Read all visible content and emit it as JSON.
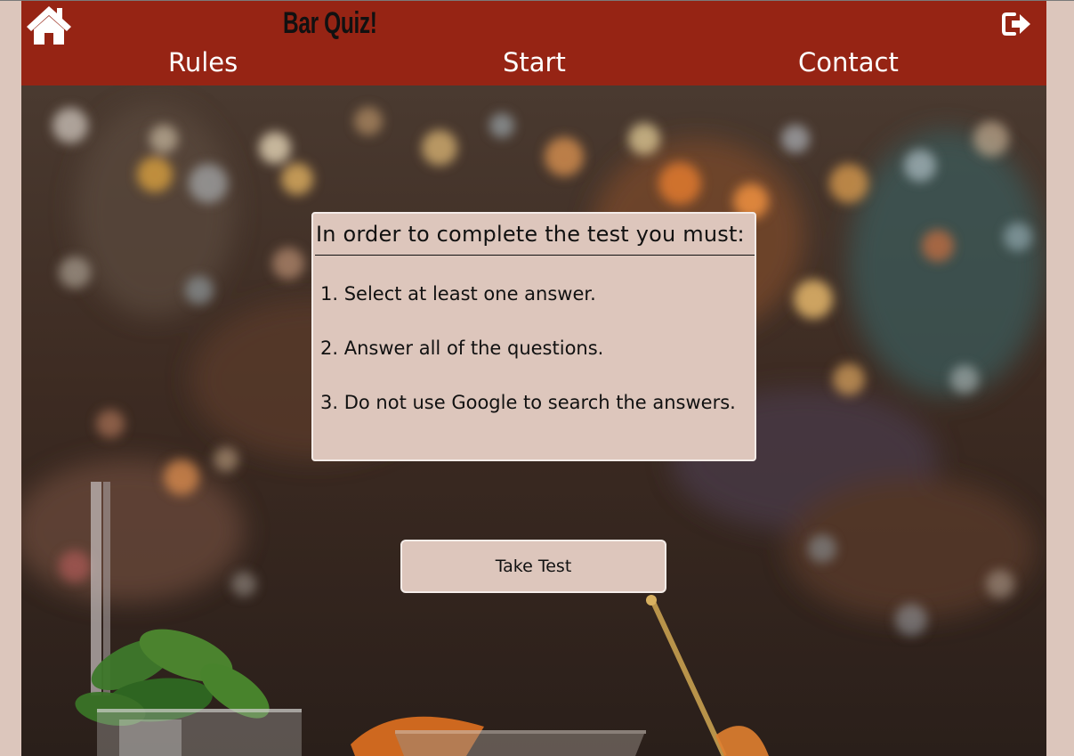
{
  "header": {
    "title": "Bar Quiz!",
    "home_icon": "home-icon",
    "logout_icon": "logout-icon",
    "nav": [
      "Rules",
      "Start",
      "Contact"
    ],
    "color": "#962414"
  },
  "rules": {
    "heading": "In order to complete the test you must:",
    "items": [
      "1. Select at least one answer.",
      "2. Answer all of the questions.",
      "3. Do not use Google to search the answers."
    ]
  },
  "cta": {
    "label": "Take Test"
  },
  "colors": {
    "panel": "#ddc6bc",
    "page": "#dcc6bc",
    "nav_text": "#ffffff"
  }
}
